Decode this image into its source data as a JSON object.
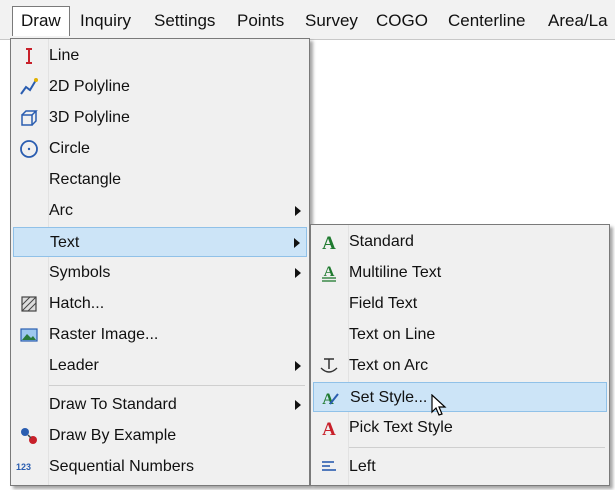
{
  "menubar": {
    "items": [
      {
        "label": "Draw"
      },
      {
        "label": "Inquiry"
      },
      {
        "label": "Settings"
      },
      {
        "label": "Points"
      },
      {
        "label": "Survey"
      },
      {
        "label": "COGO"
      },
      {
        "label": "Centerline"
      },
      {
        "label": "Area/La"
      }
    ]
  },
  "draw_menu": {
    "items": [
      {
        "label": "Line",
        "icon": "line-icon"
      },
      {
        "label": "2D Polyline",
        "icon": "2d-polyline-icon"
      },
      {
        "label": "3D Polyline",
        "icon": "3d-polyline-icon"
      },
      {
        "label": "Circle",
        "icon": "circle-icon"
      },
      {
        "label": "Rectangle"
      },
      {
        "label": "Arc",
        "submenu": true
      },
      {
        "label": "Text",
        "submenu": true,
        "highlighted": true
      },
      {
        "label": "Symbols",
        "submenu": true
      },
      {
        "label": "Hatch...",
        "icon": "hatch-icon"
      },
      {
        "label": "Raster Image...",
        "icon": "raster-image-icon"
      },
      {
        "label": "Leader",
        "submenu": true
      },
      {
        "label": "Draw To Standard",
        "submenu": true
      },
      {
        "label": "Draw By Example",
        "icon": "draw-by-example-icon"
      },
      {
        "label": "Sequential Numbers",
        "icon": "sequential-numbers-icon",
        "icon_text": "123"
      }
    ]
  },
  "text_submenu": {
    "items": [
      {
        "label": "Standard",
        "icon": "standard-text-icon"
      },
      {
        "label": "Multiline Text",
        "icon": "multiline-text-icon"
      },
      {
        "label": "Field Text"
      },
      {
        "label": "Text on Line"
      },
      {
        "label": "Text on Arc",
        "icon": "text-on-arc-icon"
      },
      {
        "label": "Set Style...",
        "icon": "set-style-icon",
        "highlighted": true
      },
      {
        "label": "Pick Text Style",
        "icon": "pick-text-style-icon"
      },
      {
        "label": "Left",
        "icon": "align-left-icon"
      }
    ]
  },
  "colors": {
    "highlight_bg": "#cce4f7",
    "highlight_border": "#90c1e8",
    "icon_green": "#1f7a2f",
    "icon_red": "#c8202a",
    "icon_blue": "#2a5db0"
  }
}
